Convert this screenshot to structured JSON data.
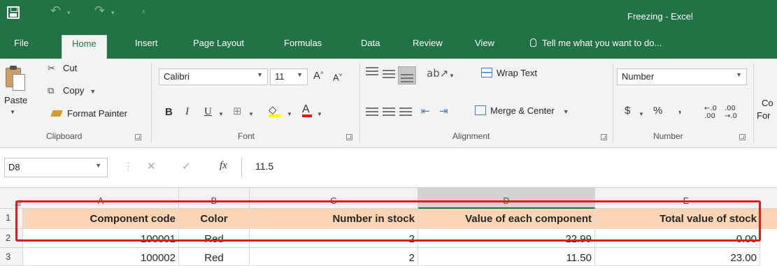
{
  "window": {
    "title": "Freezing - Excel"
  },
  "quick_access": {
    "save_icon": "save-icon",
    "undo_icon": "undo-icon",
    "redo_icon": "redo-icon",
    "customize_icon": "customize-qat-icon"
  },
  "tabs": [
    {
      "label": "File"
    },
    {
      "label": "Home",
      "active": true
    },
    {
      "label": "Insert"
    },
    {
      "label": "Page Layout"
    },
    {
      "label": "Formulas"
    },
    {
      "label": "Data"
    },
    {
      "label": "Review"
    },
    {
      "label": "View"
    }
  ],
  "tell_me": "Tell me what you want to do...",
  "ribbon": {
    "clipboard": {
      "paste": "Paste",
      "cut": "Cut",
      "copy": "Copy",
      "format_painter": "Format Painter",
      "label": "Clipboard"
    },
    "font": {
      "name": "Calibri",
      "size": "11",
      "bold": "B",
      "italic": "I",
      "underline": "U",
      "label": "Font"
    },
    "alignment": {
      "wrap_text": "Wrap Text",
      "merge_center": "Merge & Center",
      "label": "Alignment"
    },
    "number": {
      "format": "Number",
      "currency": "$",
      "percent": "%",
      "comma": ",",
      "increase_decimal": "←.0 .00",
      "decrease_decimal": ".00 →.0",
      "label": "Number"
    },
    "overflow": {
      "line1": "Co",
      "line2": "For"
    }
  },
  "formula_bar": {
    "name_box": "D8",
    "fx": "fx",
    "value": "11.5"
  },
  "grid": {
    "columns": [
      "A",
      "B",
      "C",
      "D",
      "E"
    ],
    "selected_column": "D",
    "rows": [
      {
        "row": "1",
        "cells": [
          "Component code",
          "Color",
          "Number in stock",
          "Value of each component",
          "Total value of stock"
        ]
      },
      {
        "row": "2",
        "cells": [
          "100001",
          "Red",
          "2",
          "22.99",
          "0.00"
        ]
      },
      {
        "row": "3",
        "cells": [
          "100002",
          "Red",
          "2",
          "11.50",
          "23.00"
        ]
      }
    ]
  },
  "colors": {
    "excel_green": "#217346",
    "header_fill": "#fbd5b5",
    "highlight": "#e01b1b"
  }
}
